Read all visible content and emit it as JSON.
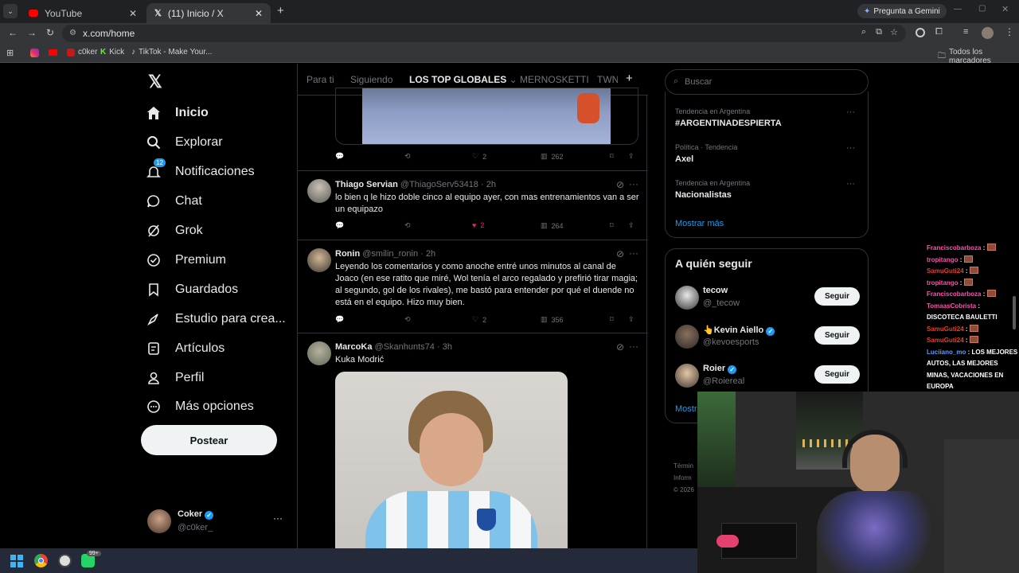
{
  "browser": {
    "tabs": [
      {
        "title": "YouTube",
        "active": false
      },
      {
        "title": "(11) Inicio / X",
        "active": true
      }
    ],
    "new_tab": "+",
    "gemini": "Pregunta a Gemini",
    "url": "x.com/home",
    "bookmarks": [
      "c0ker",
      "Kick",
      "TikTok - Make Your..."
    ],
    "all_bookmarks": "Todos los marcadores"
  },
  "nav": {
    "items": [
      "Inicio",
      "Explorar",
      "Notificaciones",
      "Chat",
      "Grok",
      "Premium",
      "Guardados",
      "Estudio para crea...",
      "Artículos",
      "Perfil",
      "Más opciones"
    ],
    "notif_badge": "12",
    "post_button": "Postear"
  },
  "profile": {
    "name": "Coker",
    "handle": "@c0ker_",
    "more": "···"
  },
  "timeline": {
    "tabs": [
      "Para ti",
      "Siguiendo",
      "LOS TOP GLOBALES",
      "MERNOSKETTI",
      "TWN"
    ],
    "add": "+",
    "top_actions": {
      "replies": "",
      "reposts": "",
      "likes": "2",
      "views": "262"
    },
    "tweets": [
      {
        "name": "Thiago Servian",
        "handle": "@ThiagoServ53418",
        "time": "· 2h",
        "text": "lo bien q le hizo doble cinco al equipo ayer, con mas entrenamientos van a ser un equipazo",
        "likes": "2",
        "views": "264"
      },
      {
        "name": "Ronin",
        "handle": "@smilin_ronin",
        "time": "· 2h",
        "text": "Leyendo los comentarios y como anoche entré unos minutos al canal de Joaco (en ese ratito que miré, Wol tenía el arco regalado y prefirió tirar magia; al segundo, gol de los rivales), me bastó para entender por qué el duende no está en el equipo. Hizo muy bien.",
        "likes": "2",
        "views": "356"
      },
      {
        "name": "MarcoKa",
        "handle": "@Skanhunts74",
        "time": "· 3h",
        "text": "Kuka Modrić"
      }
    ]
  },
  "right": {
    "search_placeholder": "Buscar",
    "trends": [
      {
        "meta": "Tendencia en Argentina",
        "name": "#ARGENTINADESPIERTA"
      },
      {
        "meta": "Política · Tendencia",
        "name": "Axel"
      },
      {
        "meta": "Tendencia en Argentina",
        "name": "Nacionalistas"
      }
    ],
    "show_more": "Mostrar más",
    "who_to_follow_title": "A quién seguir",
    "follow": [
      {
        "name": "tecow",
        "handle": "@_tecow",
        "button": "Seguir"
      },
      {
        "name": "👆Kevin Aiello",
        "handle": "@kevoesports",
        "button": "Seguir"
      },
      {
        "name": "Roier",
        "handle": "@Roiereal",
        "button": "Seguir"
      }
    ],
    "show_more_partial": "Mostr",
    "footer": [
      "Términ",
      "Inform",
      "© 2026"
    ]
  },
  "chat": [
    {
      "user": "Franciscobarboza",
      "color": "#ff4fb0",
      "msg": "",
      "emote": true
    },
    {
      "user": "tropitango",
      "color": "#ff4fb0",
      "msg": "",
      "emote": true
    },
    {
      "user": "SamuGuti24",
      "color": "#e0402a",
      "msg": "",
      "emote": true
    },
    {
      "user": "tropitango",
      "color": "#ff4fb0",
      "msg": "",
      "emote": true
    },
    {
      "user": "Franciscobarboza",
      "color": "#ff4fb0",
      "msg": "",
      "emote": true
    },
    {
      "user": "TomaasCobrista",
      "color": "#ff4fb0",
      "msg": "",
      "emote": false
    },
    {
      "user": "",
      "color": "#ffffff",
      "msg": "DISCOTECA BAULETTI",
      "emote": false
    },
    {
      "user": "SamuGuti24",
      "color": "#e0402a",
      "msg": "",
      "emote": true
    },
    {
      "user": "SamuGuti24",
      "color": "#e0402a",
      "msg": "",
      "emote": true
    },
    {
      "user": "Luciiano_mo",
      "color": "#5b9cff",
      "msg": "LOS MEJORES",
      "emote": false
    },
    {
      "user": "",
      "color": "#ffffff",
      "msg": "AUTOS, LAS MEJORES",
      "emote": false
    },
    {
      "user": "",
      "color": "#ffffff",
      "msg": "MINAS, VACACIONES EN",
      "emote": false
    },
    {
      "user": "",
      "color": "#ffffff",
      "msg": "EUROPA",
      "emote": false
    }
  ],
  "taskbar": {
    "whatsapp_badge": "99+"
  },
  "colors": {
    "accent": "#1d9bf0",
    "like": "#f91880"
  }
}
